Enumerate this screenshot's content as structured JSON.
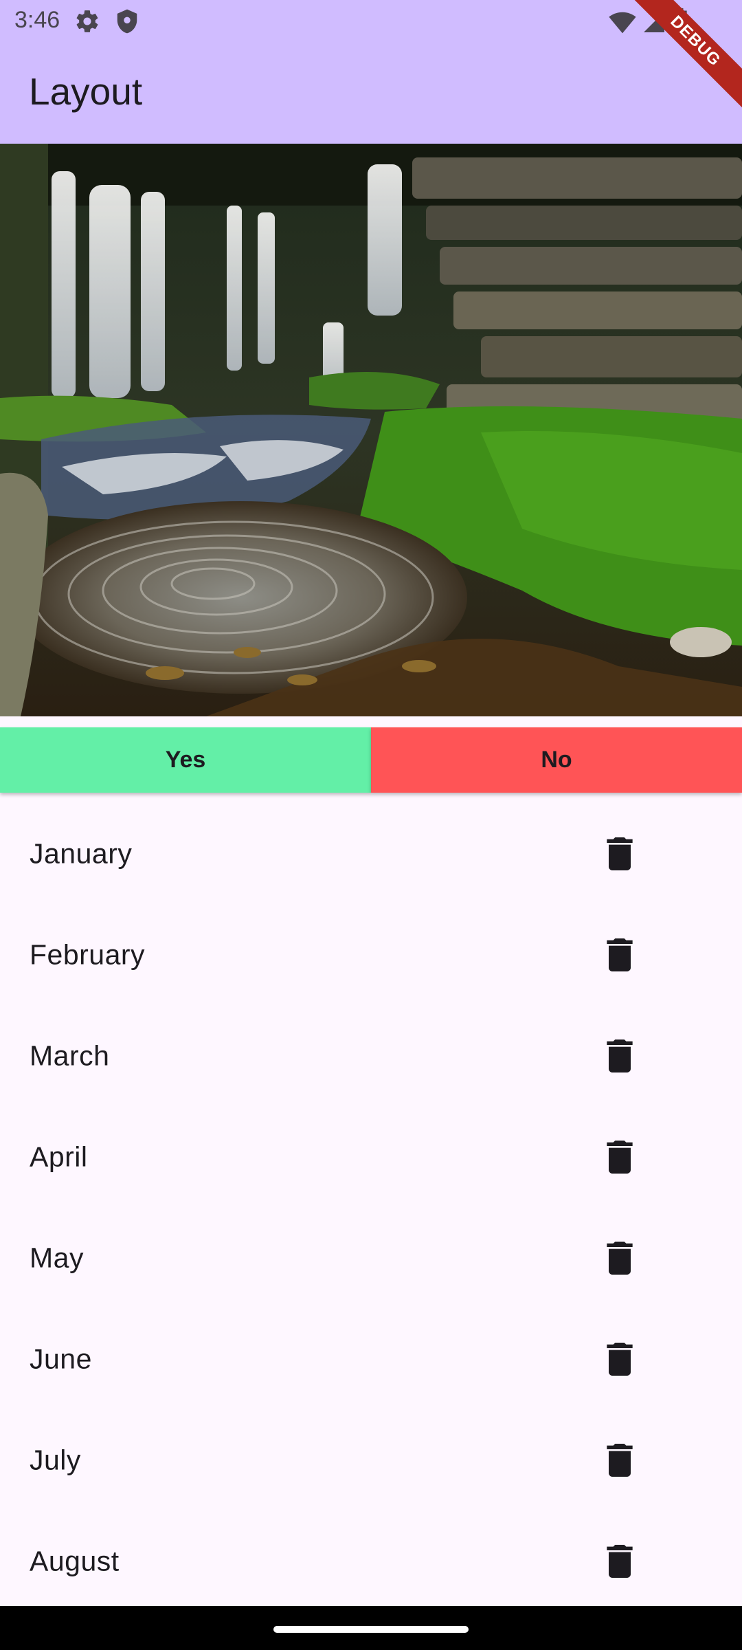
{
  "status_bar": {
    "time": "3:46",
    "icons_left": [
      "gear-icon",
      "shield-icon"
    ],
    "icons_right": [
      "wifi-icon",
      "signal-icon",
      "battery-icon"
    ]
  },
  "app_bar": {
    "title": "Layout",
    "color": "#d0bcff"
  },
  "debug_banner": "DEBUG",
  "hero_image": {
    "description_icon": "waterfall-photo"
  },
  "buttons": {
    "yes_label": "Yes",
    "no_label": "No",
    "yes_color": "#63efa7",
    "no_color": "#ff5456"
  },
  "list": {
    "items": [
      {
        "label": "January"
      },
      {
        "label": "February"
      },
      {
        "label": "March"
      },
      {
        "label": "April"
      },
      {
        "label": "May"
      },
      {
        "label": "June"
      },
      {
        "label": "July"
      },
      {
        "label": "August"
      }
    ],
    "item_icon": "trash-icon"
  }
}
